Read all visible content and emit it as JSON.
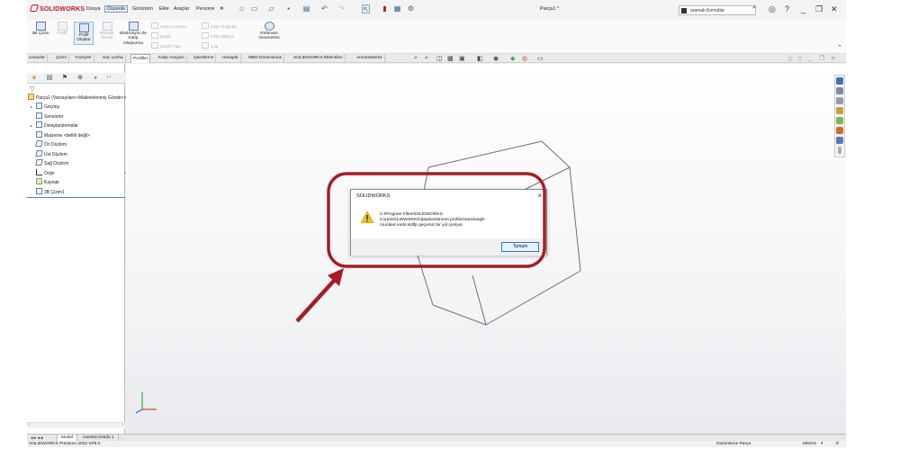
{
  "app": {
    "brand": "SOLIDWORKS",
    "document_title": "Parça1 *",
    "search_placeholder": "aramak Komutlar",
    "menus": [
      "Dosya",
      "Düzenle",
      "Görünüm",
      "Ekle",
      "Araçlar",
      "Pencere"
    ],
    "pin": "✱"
  },
  "ribbon": {
    "buttons": [
      {
        "label": "3B Çizim",
        "state": "normal"
      },
      {
        "label": "Profil",
        "state": "dim"
      },
      {
        "label": "Profil Oluştur",
        "state": "selected"
      },
      {
        "label": "Birleşik Kenar",
        "state": "dim"
      },
      {
        "label": "Ekstrüzyon ile Kalıp Oluşturma",
        "state": "normal"
      },
      {
        "label": "Referans Geometrisi",
        "state": "normal"
      }
    ],
    "small_items": [
      "Kirpla Uzatma",
      "Başlık",
      "Köşeli Tıpa",
      "Köşe Dolgusu",
      "Köşe Bitişimi",
      "Kaynak Tıpası",
      "Çap",
      "Kaynak Kordonu"
    ]
  },
  "command_tabs": [
    "Unsurlar",
    "Çizim",
    "Yüzeyler",
    "Sac Levha",
    "Profiller",
    "Kalıp Araçları",
    "İşaretleme",
    "Hesapla",
    "MBD Dimensions",
    "SOLIDWORKS Eklentileri",
    "AnnotaWorks"
  ],
  "active_tab": "Profiller",
  "feature_tree": {
    "root": "Parça1 (Varsayılan<<Makinelenmiş Gövde>>)",
    "items": [
      "Geçmiş",
      "Sensörler",
      "Detaylandırmalar",
      "Malzeme <belirli değil>",
      "Ön Düzlem",
      "Üst Düzlem",
      "Sağ Düzlem",
      "Orijin",
      "Kaynak",
      "3B Çizim1"
    ]
  },
  "bottom_tabs": [
    "Model",
    "Hareket Etüdü 1"
  ],
  "status": {
    "left": "SOLIDWORKS Premium 2022 SP5.0",
    "mode": "Düzenleme Parça",
    "units": "MMGS"
  },
  "dialog": {
    "title": "SOLIDWORKS",
    "message_line1": "C:\\Program Files\\SOLIDWORKS",
    "message_line2": "Corp\\SOLIDWORKS\\data\\weldment profiles\\ansi\\angle",
    "message_line3": "rounded ends.sldlfp geçersiz bir yol içeriyor.",
    "ok_label": "Tamam"
  },
  "colors": {
    "annotation_red": "#a51c27",
    "accent_blue": "#2f73c9",
    "brand_red": "#c8102e"
  }
}
